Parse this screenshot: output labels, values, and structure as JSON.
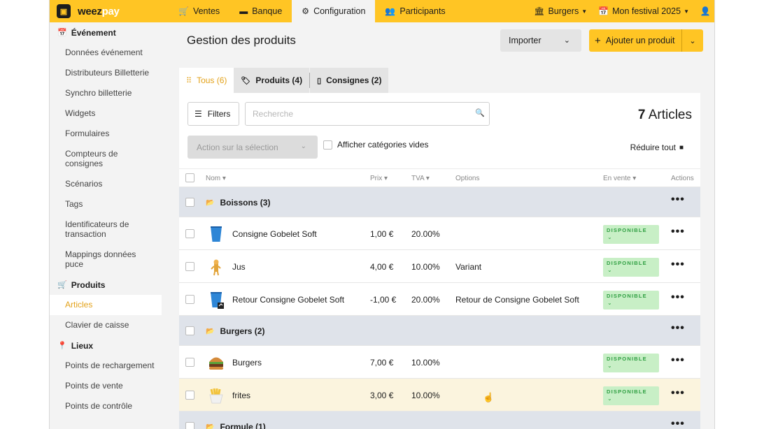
{
  "brand": {
    "name_part1": "weez",
    "name_part2": "pay"
  },
  "nav": {
    "tabs": [
      {
        "label": "Ventes",
        "icon": "cart-icon"
      },
      {
        "label": "Banque",
        "icon": "banknote-icon"
      },
      {
        "label": "Configuration",
        "icon": "gear-icon"
      },
      {
        "label": "Participants",
        "icon": "users-icon"
      }
    ],
    "active_tab": "Configuration",
    "store_selector": "Burgers",
    "event_selector": "Mon festival 2025"
  },
  "sidebar": {
    "sections": [
      {
        "title": "Événement",
        "icon": "calendar-icon",
        "items": [
          "Données événement",
          "Distributeurs Billetterie",
          "Synchro billetterie",
          "Widgets",
          "Formulaires",
          "Compteurs de consignes",
          "Scénarios",
          "Tags",
          "Identificateurs de transaction",
          "Mappings données puce"
        ]
      },
      {
        "title": "Produits",
        "icon": "cart-icon",
        "items": [
          "Articles",
          "Clavier de caisse"
        ]
      },
      {
        "title": "Lieux",
        "icon": "pin-icon",
        "items": [
          "Points de rechargement",
          "Points de vente",
          "Points de contrôle"
        ]
      }
    ],
    "active_item": "Articles"
  },
  "page": {
    "title": "Gestion des produits",
    "import_label": "Importer",
    "add_label": "Ajouter un produit"
  },
  "tabs": [
    {
      "label": "Tous (6)",
      "icon": "grid-icon"
    },
    {
      "label": "Produits (4)",
      "icon": "tag-icon"
    },
    {
      "label": "Consignes (2)",
      "icon": "cup-icon"
    }
  ],
  "toolbar": {
    "filters_label": "Filters",
    "search_placeholder": "Recherche",
    "count_number": "7",
    "count_label": "Articles",
    "bulk_action_label": "Action sur la sélection",
    "show_empty_label": "Afficher catégories vides",
    "collapse_label": "Réduire tout"
  },
  "table": {
    "headers": {
      "name": "Nom",
      "price": "Prix",
      "tva": "TVA",
      "options": "Options",
      "on_sale": "En vente",
      "actions": "Actions"
    },
    "rows": [
      {
        "type": "group",
        "title": "Boissons (3)"
      },
      {
        "type": "item",
        "name": "Consigne Gobelet Soft",
        "price": "1,00 €",
        "tva": "20.00%",
        "options": "",
        "status": "DISPONIBLE",
        "thumb": "cup"
      },
      {
        "type": "item",
        "name": "Jus",
        "price": "4,00 €",
        "tva": "10.00%",
        "options": "Variant",
        "status": "DISPONIBLE",
        "thumb": "juice"
      },
      {
        "type": "item",
        "name": "Retour Consigne Gobelet Soft",
        "price": "-1,00 €",
        "tva": "20.00%",
        "options": "Retour de Consigne Gobelet Soft",
        "status": "DISPONIBLE",
        "thumb": "cup-return"
      },
      {
        "type": "group",
        "title": "Burgers (2)"
      },
      {
        "type": "item",
        "name": "Burgers",
        "price": "7,00 €",
        "tva": "10.00%",
        "options": "",
        "status": "DISPONIBLE",
        "thumb": "burger"
      },
      {
        "type": "item",
        "name": "frites",
        "price": "3,00 €",
        "tva": "10.00%",
        "options": "",
        "status": "DISPONIBLE",
        "thumb": "fries",
        "hover": true
      },
      {
        "type": "group",
        "title": "Formule (1)"
      }
    ]
  }
}
